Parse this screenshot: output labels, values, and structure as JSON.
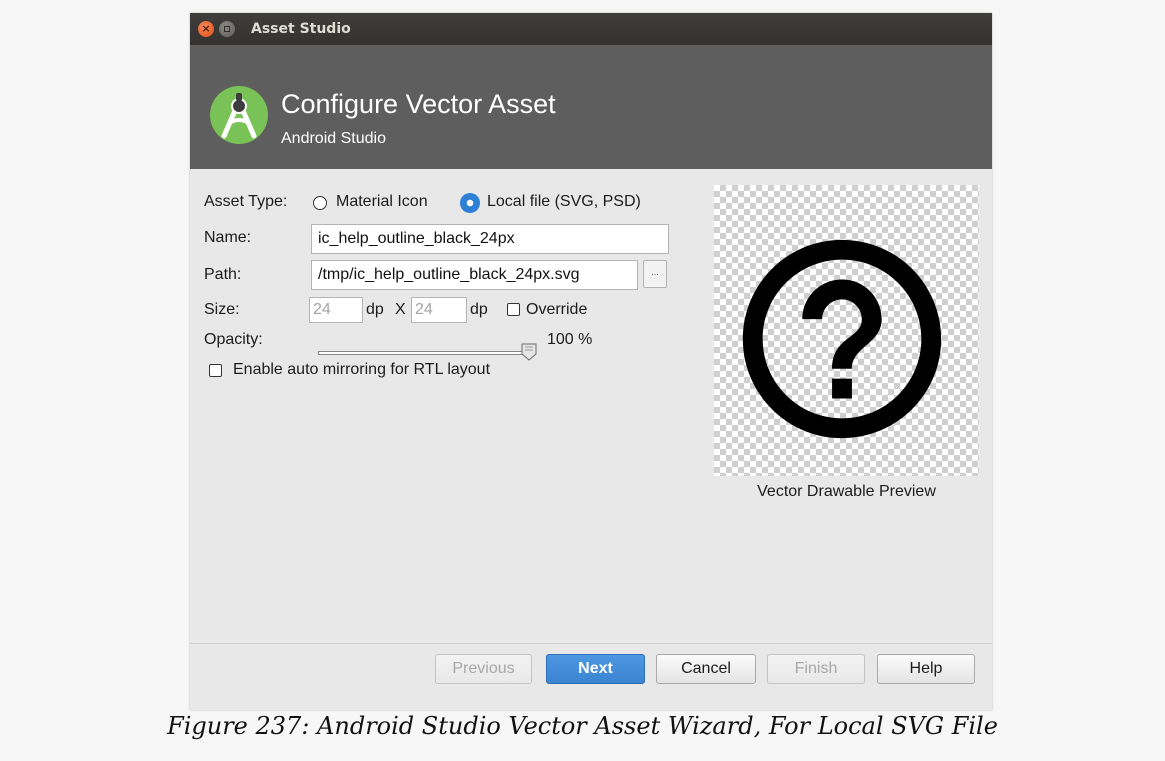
{
  "window": {
    "title": "Asset Studio"
  },
  "header": {
    "title": "Configure Vector Asset",
    "subtitle": "Android Studio"
  },
  "form": {
    "asset_type_label": "Asset Type:",
    "option_material": "Material Icon",
    "option_local": "Local file (SVG, PSD)",
    "selected_option": "Local file (SVG, PSD)",
    "name_label": "Name:",
    "name_value": "ic_help_outline_black_24px",
    "path_label": "Path:",
    "path_value": "/tmp/ic_help_outline_black_24px.svg",
    "browse_label": "...",
    "size_label": "Size:",
    "width_value": "24",
    "dp_unit": "dp",
    "x_sep": "X",
    "height_value": "24",
    "override_label": "Override",
    "opacity_label": "Opacity:",
    "opacity_value": "100 %",
    "opacity_level": 1.0,
    "mirroring_label": "Enable auto mirroring for RTL layout"
  },
  "preview": {
    "caption": "Vector Drawable Preview",
    "icon": "help-outline-icon"
  },
  "buttons": {
    "previous": "Previous",
    "next": "Next",
    "cancel": "Cancel",
    "finish": "Finish",
    "help": "Help"
  },
  "figure_caption": "Figure 237: Android Studio Vector Asset Wizard, For Local SVG File",
  "colors": {
    "accent": "#3a84d2",
    "logo_green": "#78c257",
    "header_bg": "#5e5e5e"
  }
}
